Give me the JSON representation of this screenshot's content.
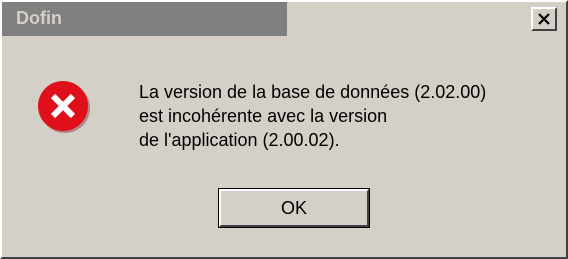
{
  "window": {
    "title": "Dofin",
    "close_icon": "close-icon"
  },
  "dialog": {
    "icon": "error-icon",
    "message_lines": [
      "La version de la base de données (2.02.00)",
      "est incohérente avec la version",
      "de l'application (2.00.02)."
    ],
    "ok_label": "OK"
  },
  "colors": {
    "face": "#d4d0c8",
    "inactive_title": "#808080",
    "error_red": "#e0101a"
  }
}
